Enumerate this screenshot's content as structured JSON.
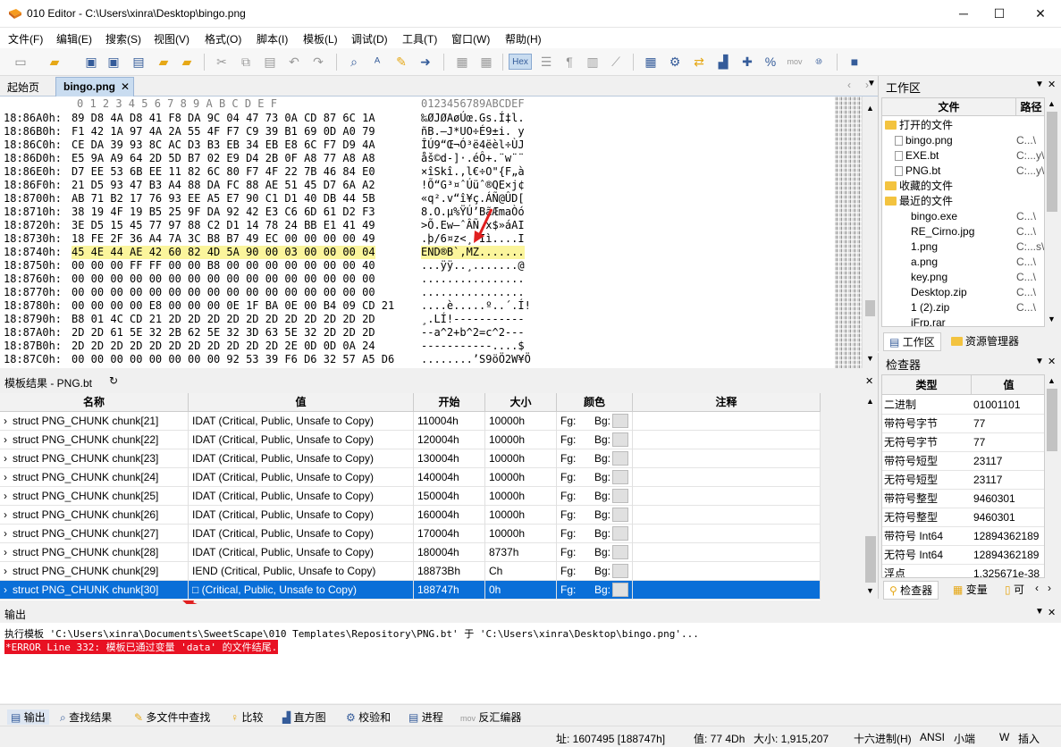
{
  "window": {
    "title": "010 Editor - C:\\Users\\xinra\\Desktop\\bingo.png",
    "minimize": "─",
    "maximize": "☐",
    "close": "✕"
  },
  "menu": [
    "文件(F)",
    "编辑(E)",
    "搜索(S)",
    "视图(V)",
    "格式(O)",
    "脚本(I)",
    "模板(L)",
    "调试(D)",
    "工具(T)",
    "窗口(W)",
    "帮助(H)"
  ],
  "tabs": {
    "start": "起始页",
    "file": "bingo.png",
    "close": "✕"
  },
  "hex": {
    "header_cols": "0   1   2   3   4   5   6   7   8   9   A   B   C   D   E   F",
    "header_ascii": "0123456789ABCDEF",
    "rows": [
      {
        "addr": "18:86A0h:",
        "bytes": "89 D8 4A D8 41 F8 DA 9C 04 47 73 0A CD 87 6C 1A",
        "ascii": "‰ØJØAøÚœ.Gs.Í‡l."
      },
      {
        "addr": "18:86B0h:",
        "bytes": "F1 42 1A 97 4A 2A 55 4F F7 C9 39 B1 69 0D A0 79",
        "ascii": "ñB.—J*UO÷É9±i. y"
      },
      {
        "addr": "18:86C0h:",
        "bytes": "CE DA 39 93 8C AC D3 B3 EB 34 EB E8 6C F7 D9 4A",
        "ascii": "ÎÚ9“Œ¬Ó³ë4ëèl÷ÙJ"
      },
      {
        "addr": "18:86D0h:",
        "bytes": "E5 9A A9 64 2D 5D B7 02 E9 D4 2B 0F A8 77 A8 A8",
        "ascii": "åš©d-]·.éÔ+.¨w¨¨"
      },
      {
        "addr": "18:86E0h:",
        "bytes": "D7 EE 53 6B EE 11 82 6C 80 F7 4F 22 7B 46 84 E0",
        "ascii": "×îSkî.‚l€÷O\"{F„à"
      },
      {
        "addr": "18:86F0h:",
        "bytes": "21 D5 93 47 B3 A4 88 DA FC 88 AE 51 45 D7 6A A2",
        "ascii": "!Õ“G³¤ˆÚüˆ®QE×j¢"
      },
      {
        "addr": "18:8700h:",
        "bytes": "AB 71 B2 17 76 93 EE A5 E7 90 C1 D1 40 DB 44 5B",
        "ascii": "«q².v“î¥ç.ÁÑ@ÛD["
      },
      {
        "addr": "18:8710h:",
        "bytes": "38 19 4F 19 B5 25 9F DA 92 42 E3 C6 6D 61 D2 F3",
        "ascii": "8.O.µ%ŸÚ’BãÆmaÒó"
      },
      {
        "addr": "18:8720h:",
        "bytes": "3E D5 15 45 77 97 88 C2 D1 14 78 24 BB E1 41 49",
        "ascii": ">Õ.Ew—ˆÂÑ.x$»áAI"
      },
      {
        "addr": "18:8730h:",
        "bytes": "18 FE 2F 36 A4 7A 3C B8 B7 49 EC 00 00 00 00 49",
        "ascii": ".þ/6¤z<¸·Iì....I"
      },
      {
        "addr": "18:8740h:",
        "bytes": "45 4E 44 AE 42 60 82 4D 5A 90 00 03 00 00 00 04",
        "ascii": "END®B`‚MZ......."
      },
      {
        "addr": "18:8750h:",
        "bytes": "00 00 00 FF FF 00 00 B8 00 00 00 00 00 00 00 40",
        "ascii": "...ÿÿ..¸.......@"
      },
      {
        "addr": "18:8760h:",
        "bytes": "00 00 00 00 00 00 00 00 00 00 00 00 00 00 00 00",
        "ascii": "................"
      },
      {
        "addr": "18:8770h:",
        "bytes": "00 00 00 00 00 00 00 00 00 00 00 00 00 00 00 00",
        "ascii": "................"
      },
      {
        "addr": "18:8780h:",
        "bytes": "00 00 00 00 E8 00 00 00 0E 1F BA 0E 00 B4 09 CD 21",
        "ascii": "....è.....º..´.Í!"
      },
      {
        "addr": "18:8790h:",
        "bytes": "B8 01 4C CD 21 2D 2D 2D 2D 2D 2D 2D 2D 2D 2D 2D",
        "ascii": "¸.LÍ!-----------"
      },
      {
        "addr": "18:87A0h:",
        "bytes": "2D 2D 61 5E 32 2B 62 5E 32 3D 63 5E 32 2D 2D 2D",
        "ascii": "--a^2+b^2=c^2---"
      },
      {
        "addr": "18:87B0h:",
        "bytes": "2D 2D 2D 2D 2D 2D 2D 2D 2D 2D 2D 2E 0D 0D 0A 24",
        "ascii": "-----------....$"
      },
      {
        "addr": "18:87C0h:",
        "bytes": "00 00 00 00 00 00 00 00 92 53 39 F6 D6 32 57 A5 D6",
        "ascii": "........’S9öÖ2W¥Ö"
      }
    ],
    "highlight_row": 10
  },
  "template": {
    "bar_title": "模板结果 - PNG.bt",
    "refresh_icon": "↻",
    "close": "✕",
    "columns": [
      "名称",
      "值",
      "开始",
      "大小",
      "颜色",
      "注释"
    ],
    "rows": [
      {
        "name": "struct PNG_CHUNK chunk[21]",
        "value": "IDAT  (Critical, Public, Unsafe to Copy)",
        "start": "110004h",
        "size": "10000h",
        "fg": "Fg:",
        "bg": "Bg:"
      },
      {
        "name": "struct PNG_CHUNK chunk[22]",
        "value": "IDAT  (Critical, Public, Unsafe to Copy)",
        "start": "120004h",
        "size": "10000h",
        "fg": "Fg:",
        "bg": "Bg:"
      },
      {
        "name": "struct PNG_CHUNK chunk[23]",
        "value": "IDAT  (Critical, Public, Unsafe to Copy)",
        "start": "130004h",
        "size": "10000h",
        "fg": "Fg:",
        "bg": "Bg:"
      },
      {
        "name": "struct PNG_CHUNK chunk[24]",
        "value": "IDAT  (Critical, Public, Unsafe to Copy)",
        "start": "140004h",
        "size": "10000h",
        "fg": "Fg:",
        "bg": "Bg:"
      },
      {
        "name": "struct PNG_CHUNK chunk[25]",
        "value": "IDAT  (Critical, Public, Unsafe to Copy)",
        "start": "150004h",
        "size": "10000h",
        "fg": "Fg:",
        "bg": "Bg:"
      },
      {
        "name": "struct PNG_CHUNK chunk[26]",
        "value": "IDAT  (Critical, Public, Unsafe to Copy)",
        "start": "160004h",
        "size": "10000h",
        "fg": "Fg:",
        "bg": "Bg:"
      },
      {
        "name": "struct PNG_CHUNK chunk[27]",
        "value": "IDAT  (Critical, Public, Unsafe to Copy)",
        "start": "170004h",
        "size": "10000h",
        "fg": "Fg:",
        "bg": "Bg:"
      },
      {
        "name": "struct PNG_CHUNK chunk[28]",
        "value": "IDAT  (Critical, Public, Unsafe to Copy)",
        "start": "180004h",
        "size": "8737h",
        "fg": "Fg:",
        "bg": "Bg:"
      },
      {
        "name": "struct PNG_CHUNK chunk[29]",
        "value": "IEND  (Critical, Public, Unsafe to Copy)",
        "start": "18873Bh",
        "size": "Ch",
        "fg": "Fg:",
        "bg": "Bg:"
      },
      {
        "name": "struct PNG_CHUNK chunk[30]",
        "value": "□  (Critical, Public, Unsafe to Copy)",
        "start": "188747h",
        "size": "0h",
        "fg": "Fg:",
        "bg": "Bg:"
      }
    ],
    "selected_row": 9
  },
  "output": {
    "title": "输出",
    "line1": "执行模板 'C:\\Users\\xinra\\Documents\\SweetScape\\010 Templates\\Repository\\PNG.bt' 于 'C:\\Users\\xinra\\Desktop\\bingo.png'...",
    "error": "*ERROR Line 332: 模板已通过变量 'data' 的文件结尾.",
    "error_color": "#e81123"
  },
  "bottom_tabs": [
    "输出",
    "查找结果",
    "多文件中查找",
    "比较",
    "直方图",
    "校验和",
    "进程",
    "反汇编器"
  ],
  "status": {
    "addr": "址: 1607495 [188747h]",
    "value": "值: 77 4Dh",
    "size": "大小: 1,915,207",
    "mode": "十六进制(H)",
    "encoding": "ANSI",
    "endian": "小端",
    "w": "W",
    "insert": "插入"
  },
  "workspace": {
    "title": "工作区",
    "col_file": "文件",
    "col_path": "路径",
    "items": [
      {
        "indent": 0,
        "icon": "folder",
        "name": "打开的文件",
        "path": ""
      },
      {
        "indent": 1,
        "icon": "file",
        "name": "bingo.png",
        "path": "C...\\"
      },
      {
        "indent": 1,
        "icon": "file",
        "name": "EXE.bt",
        "path": "C:...y\\"
      },
      {
        "indent": 1,
        "icon": "file",
        "name": "PNG.bt",
        "path": "C:...y\\"
      },
      {
        "indent": 0,
        "icon": "folder",
        "name": "收藏的文件",
        "path": ""
      },
      {
        "indent": 0,
        "icon": "folder",
        "name": "最近的文件",
        "path": ""
      },
      {
        "indent": 1,
        "icon": "none",
        "name": "bingo.exe",
        "path": "C...\\"
      },
      {
        "indent": 1,
        "icon": "none",
        "name": "RE_Cirno.jpg",
        "path": "C...\\"
      },
      {
        "indent": 1,
        "icon": "none",
        "name": "1.png",
        "path": "C:...s\\"
      },
      {
        "indent": 1,
        "icon": "none",
        "name": "a.png",
        "path": "C...\\"
      },
      {
        "indent": 1,
        "icon": "none",
        "name": "key.png",
        "path": "C...\\"
      },
      {
        "indent": 1,
        "icon": "none",
        "name": "Desktop.zip",
        "path": "C...\\"
      },
      {
        "indent": 1,
        "icon": "none",
        "name": "1 (2).zip",
        "path": "C...\\"
      },
      {
        "indent": 1,
        "icon": "none",
        "name": "iFrp.rar",
        "path": ""
      }
    ],
    "tab_ws": "工作区",
    "tab_explorer": "资源管理器"
  },
  "inspector": {
    "title": "检查器",
    "col_type": "类型",
    "col_value": "值",
    "rows": [
      {
        "k": "二进制",
        "v": "01001101"
      },
      {
        "k": "带符号字节",
        "v": "77"
      },
      {
        "k": "无符号字节",
        "v": "77"
      },
      {
        "k": "带符号短型",
        "v": "23117"
      },
      {
        "k": "无符号短型",
        "v": "23117"
      },
      {
        "k": "带符号整型",
        "v": "9460301"
      },
      {
        "k": "无符号整型",
        "v": "9460301"
      },
      {
        "k": "带符号 Int64",
        "v": "12894362189"
      },
      {
        "k": "无符号 Int64",
        "v": "12894362189"
      },
      {
        "k": "浮点",
        "v": "1.325671e-38"
      }
    ],
    "tab_inspector": "检查器",
    "tab_vars": "变量",
    "tab_more": "可"
  }
}
